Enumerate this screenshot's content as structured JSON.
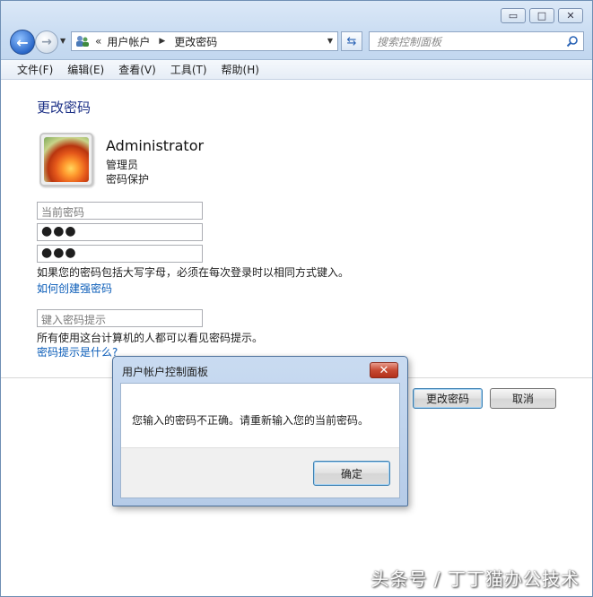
{
  "window": {
    "minimize_glyph": "▭",
    "maximize_glyph": "□",
    "close_glyph": "✕"
  },
  "address_bar": {
    "chevron": "«",
    "segments": [
      "用户帐户",
      "更改密码"
    ],
    "separator": "▶"
  },
  "search": {
    "placeholder": "搜索控制面板"
  },
  "menu": [
    "文件(F)",
    "编辑(E)",
    "查看(V)",
    "工具(T)",
    "帮助(H)"
  ],
  "page": {
    "title": "更改密码",
    "user": {
      "name": "Administrator",
      "role": "管理员",
      "password_status": "密码保护"
    },
    "fields": {
      "current_password_placeholder": "当前密码",
      "new_password_value": "●●●",
      "confirm_password_value": "●●●",
      "hint_placeholder": "键入密码提示"
    },
    "case_note": "如果您的密码包括大写字母，必须在每次登录时以相同方式键入。",
    "strong_password_link": "如何创建强密码",
    "hint_note": "所有使用这台计算机的人都可以看见密码提示。",
    "hint_link": "密码提示是什么?",
    "buttons": {
      "change": "更改密码",
      "cancel": "取消"
    }
  },
  "dialog": {
    "title": "用户帐户控制面板",
    "message": "您输入的密码不正确。请重新输入您的当前密码。",
    "ok": "确定"
  },
  "watermark": "头条号 / 丁丁猫办公技术",
  "colors": {
    "accent": "#1e3287",
    "link": "#0a5cb8",
    "chrome": "#c9dcf2",
    "dialog_close": "#c74a32"
  },
  "icons": {
    "back": "arrow-left-icon",
    "forward": "arrow-right-icon",
    "location": "user-accounts-icon",
    "refresh": "refresh-icon",
    "search": "search-icon",
    "avatar": "user-flower-avatar"
  }
}
